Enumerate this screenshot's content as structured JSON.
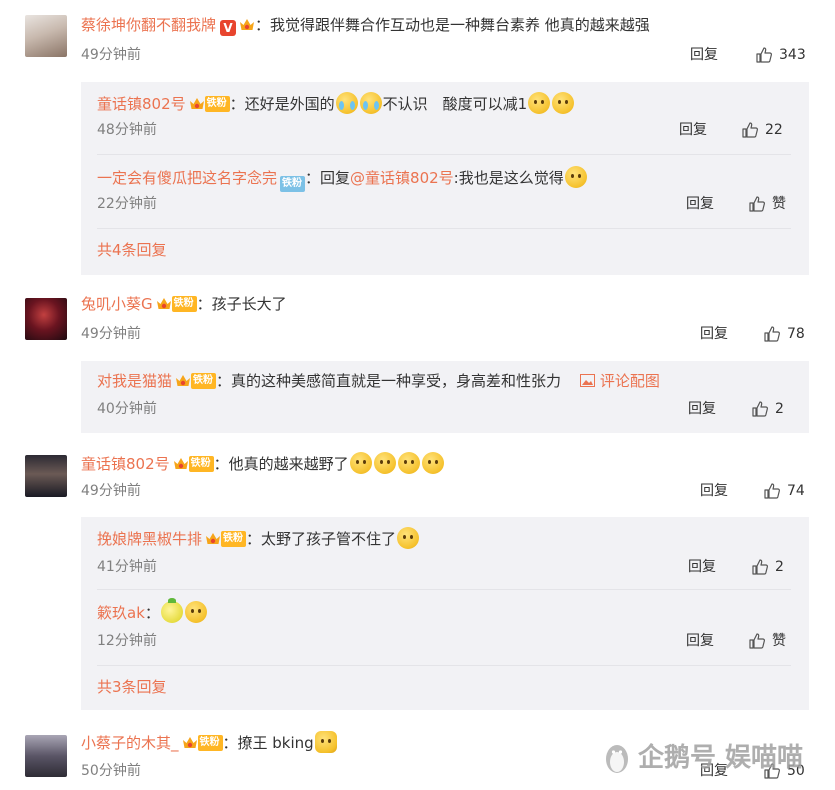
{
  "colors": {
    "username": "#eb7350",
    "text": "#333333",
    "time": "#808080",
    "reply_bg": "#f2f2f5",
    "fan_badge": "#ffb624",
    "fan_badge_blue": "#7cc1e6"
  },
  "icons": {
    "like": "thumbs-up-icon",
    "image": "picture-icon",
    "vip": "verified-v-icon",
    "crown": "crown-badge-icon"
  },
  "comments": [
    {
      "user": "蔡徐坤你翻不翻我牌",
      "text": "：我觉得跟伴舞合作互动也是一种舞台素养 他真的越来越强",
      "time": "49分钟前",
      "reply_label": "回复",
      "likes": "343",
      "replies": [
        {
          "user": "童话镇802号",
          "badge": "铁粉",
          "text": "：还好是外国的",
          "text2": "不认识　酸度可以减1",
          "time": "48分钟前",
          "reply_label": "回复",
          "likes": "22"
        },
        {
          "user": "一定会有傻瓜把这名字念完",
          "badge": "铁粉",
          "text": "：回复",
          "mention": "@童话镇802号",
          "text2": ":我也是这么觉得",
          "time": "22分钟前",
          "reply_label": "回复",
          "likes": "赞"
        }
      ],
      "more": "共4条回复"
    },
    {
      "user": "兔叽小葵G",
      "badge": "铁粉",
      "text": "：孩子长大了",
      "time": "49分钟前",
      "reply_label": "回复",
      "likes": "78",
      "replies": [
        {
          "user": "对我是猫猫",
          "badge": "铁粉",
          "text": "：真的这种美感简直就是一种享受，身高差和性张力",
          "image_link": "评论配图",
          "time": "40分钟前",
          "reply_label": "回复",
          "likes": "2"
        }
      ]
    },
    {
      "user": "童话镇802号",
      "badge": "铁粉",
      "text": "：他真的越来越野了",
      "time": "49分钟前",
      "reply_label": "回复",
      "likes": "74",
      "replies": [
        {
          "user": "挽娘牌黑椒牛排",
          "badge": "铁粉",
          "text": "：太野了孩子管不住了",
          "time": "41分钟前",
          "reply_label": "回复",
          "likes": "2"
        },
        {
          "user": "簌玖ak",
          "text": "：",
          "time": "12分钟前",
          "reply_label": "回复",
          "likes": "赞"
        }
      ],
      "more": "共3条回复"
    },
    {
      "user": "小蔡子的木其_",
      "badge": "铁粉",
      "text": "：撩王 bking",
      "time": "50分钟前",
      "reply_label": "回复",
      "likes": "50"
    }
  ],
  "watermark": "企鹅号 娱喵喵"
}
